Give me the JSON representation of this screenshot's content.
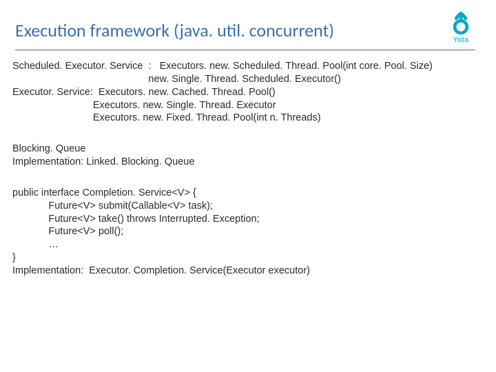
{
  "header": {
    "title": "Execution framework (java. util. concurrent)",
    "brand": "Yota"
  },
  "content": {
    "block1": "Scheduled. Executor. Service  :   Executors. new. Scheduled. Thread. Pool(int core. Pool. Size)\n                                                 new. Single. Thread. Scheduled. Executor()\nExecutor. Service:  Executors. new. Cached. Thread. Pool()\n                             Executors. new. Single. Thread. Executor\n                             Executors. new. Fixed. Thread. Pool(int n. Threads)",
    "block2": "Blocking. Queue\nImplementation: Linked. Blocking. Queue",
    "block3": "public interface Completion. Service<V> {\n             Future<V> submit(Callable<V> task);\n             Future<V> take() throws Interrupted. Exception;\n             Future<V> poll();\n             …\n}\nImplementation:  Executor. Completion. Service(Executor executor)"
  }
}
